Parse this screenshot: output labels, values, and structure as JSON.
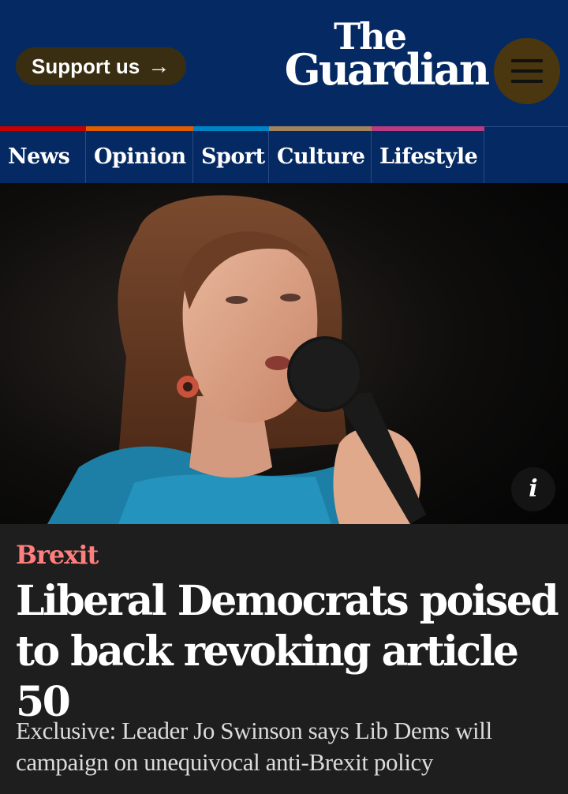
{
  "header": {
    "support_label": "Support us",
    "support_arrow": "→",
    "logo_line1": "The",
    "logo_line2": "Guardian",
    "menu_icon": "hamburger-icon"
  },
  "nav": {
    "items": [
      {
        "label": "News",
        "color": "#c70000"
      },
      {
        "label": "Opinion",
        "color": "#e05e00"
      },
      {
        "label": "Sport",
        "color": "#0084c6"
      },
      {
        "label": "Culture",
        "color": "#a1845c"
      },
      {
        "label": "Lifestyle",
        "color": "#bb3b80"
      }
    ]
  },
  "hero": {
    "info_label": "i"
  },
  "article": {
    "kicker": "Brexit",
    "headline_line1": "Liberal Democrats poised",
    "headline_line2": "to back revoking article 50",
    "standfirst_line1": "Exclusive: Leader Jo Swinson says Lib Dems will",
    "standfirst_line2": "campaign on unequivocal anti-Brexit policy"
  },
  "colors": {
    "brand_blue": "#052962",
    "kicker": "#ff7f7f",
    "background": "#1e1e1e"
  }
}
